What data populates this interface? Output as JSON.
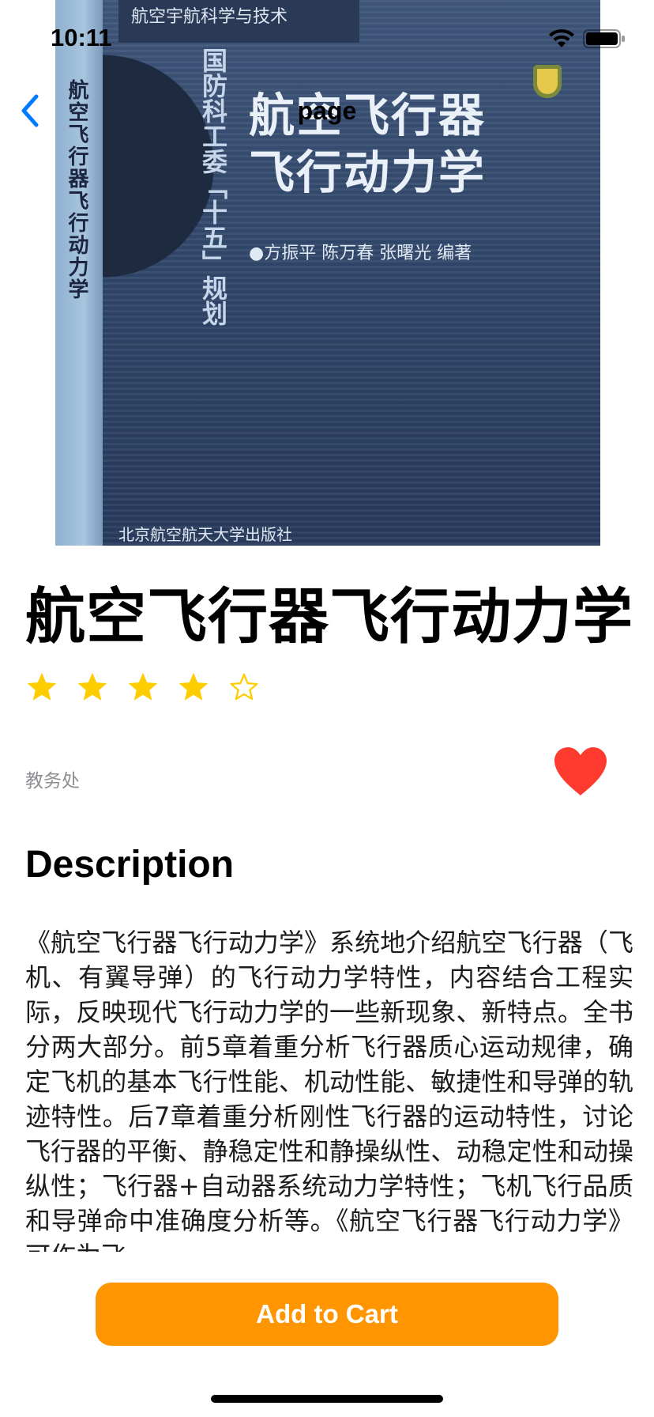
{
  "status_bar": {
    "time": "10:11",
    "icons": [
      "wifi-icon",
      "battery-icon"
    ]
  },
  "nav": {
    "title": "page",
    "back_icon": "chevron-left-icon"
  },
  "cover": {
    "series": "航空宇航科学与技术",
    "spine_title": "航空飞行器飞行动力学",
    "seal": "国防科工委「十五」规划",
    "title_line1": "航空飞行器",
    "title_line2": "飞行动力学",
    "authors": "●方振平  陈万春  张曙光  编著",
    "publisher": "北京航空航天大学出版社"
  },
  "book": {
    "title": "航空飞行器飞行动力学",
    "rating": 4,
    "rating_max": 5,
    "author": "教务处",
    "favorited": true
  },
  "description": {
    "heading": "Description",
    "text": "《航空飞行器飞行动力学》系统地介绍航空飞行器（飞机、有翼导弹）的飞行动力学特性，内容结合工程实际，反映现代飞行动力学的一些新现象、新特点。全书分两大部分。前5章着重分析飞行器质心运动规律，确定飞机的基本飞行性能、机动性能、敏捷性和导弹的轨迹特性。后7章着重分析刚性飞行器的运动特性，讨论飞行器的平衡、静稳定性和静操纵性、动稳定性和动操纵性；飞行器+自动器系统动力学特性；飞机飞行品质和导弹命中准确度分析等。《航空飞行器飞行动力学》可作为飞"
  },
  "actions": {
    "add_to_cart": "Add to Cart"
  },
  "colors": {
    "accent_blue": "#007aff",
    "star_yellow": "#ffcc00",
    "heart_red": "#ff3b30",
    "button_orange": "#ff9500"
  }
}
